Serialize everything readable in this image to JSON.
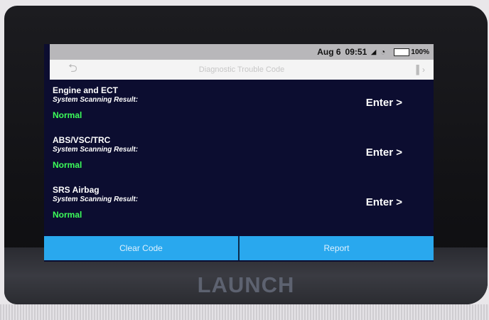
{
  "status_bar": {
    "date": "Aug 6",
    "time": "09:51",
    "battery": "100%",
    "icons": [
      "signal-icon",
      "wifi-icon",
      "battery-icon"
    ]
  },
  "header": {
    "title": "Diagnostic Trouble Code",
    "back_icon": "back-arrow-icon",
    "exit_icon": "exit-icon"
  },
  "systems": [
    {
      "name": "Engine and ECT",
      "label": "System Scanning Result:",
      "status": "Normal",
      "action": "Enter >"
    },
    {
      "name": "ABS/VSC/TRC",
      "label": "System Scanning Result:",
      "status": "Normal",
      "action": "Enter >"
    },
    {
      "name": "SRS Airbag",
      "label": "System Scanning Result:",
      "status": "Normal",
      "action": "Enter >"
    }
  ],
  "buttons": {
    "clear_code": "Clear Code",
    "report": "Report"
  },
  "device": {
    "brand": "LAUNCH"
  },
  "colors": {
    "screen_bg": "#0c0d30",
    "status_ok": "#3cff5a",
    "button_bg": "#29a8ee"
  }
}
